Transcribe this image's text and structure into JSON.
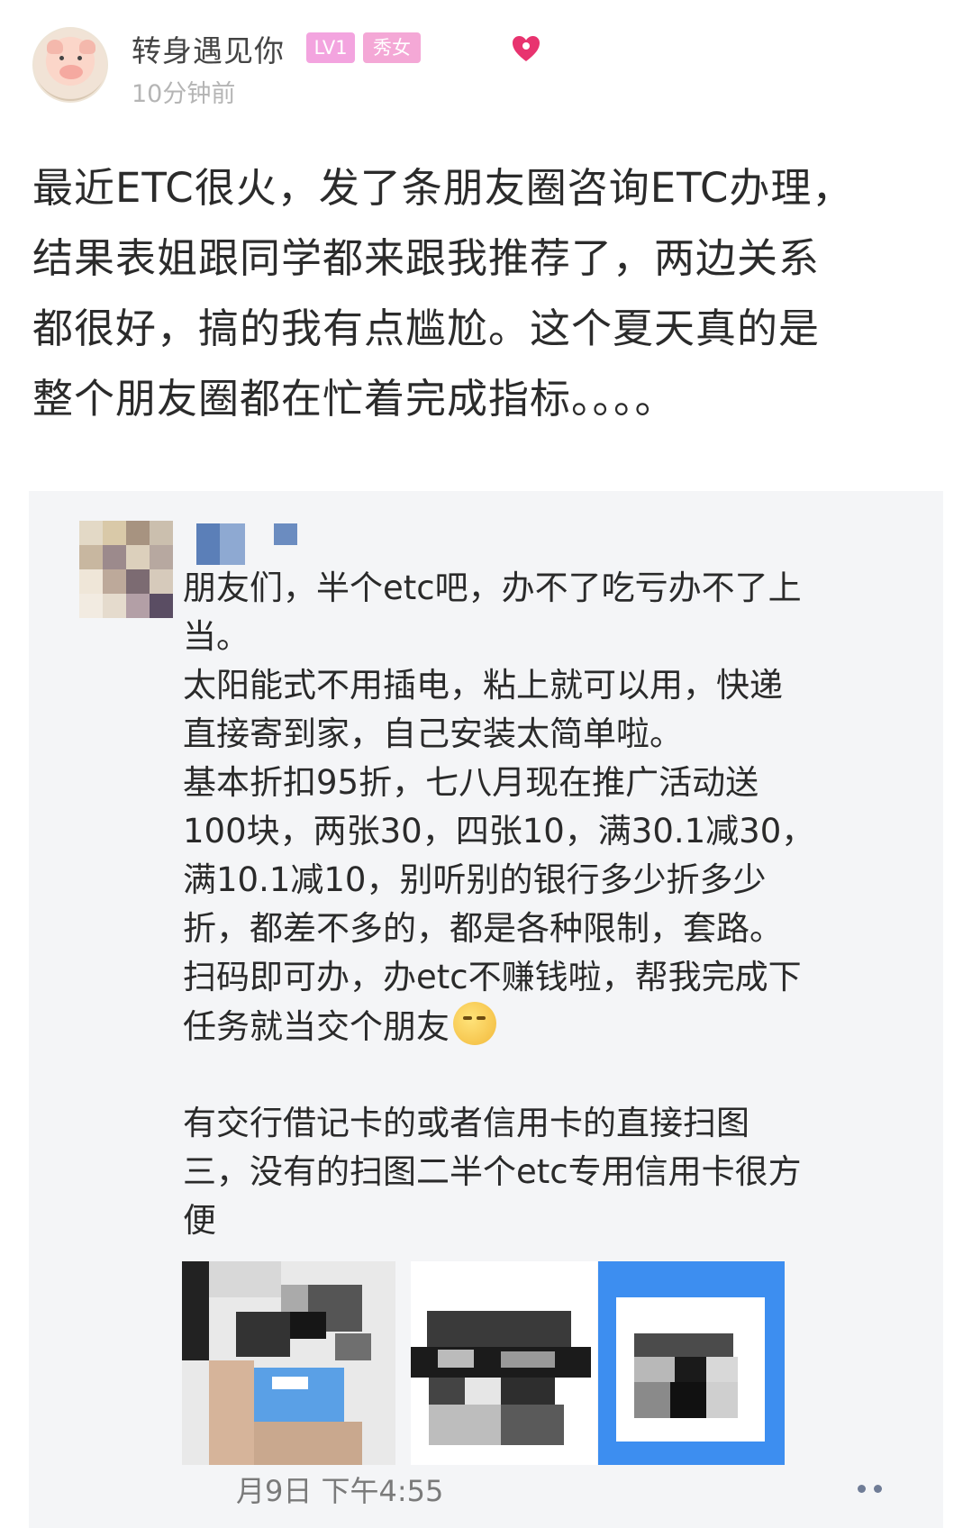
{
  "post": {
    "username": "转身遇见你",
    "level_badge": "LV1",
    "gender_badge": "秀女",
    "time": "10分钟前",
    "body_lines": [
      "最近ETC很火，发了条朋友圈咨询ETC办理，",
      "结果表姐跟同学都来跟我推荐了，两边关系",
      "都很好，搞的我有点尴尬。这个夏天真的是",
      "整个朋友圈都在忙着完成指标。。。。"
    ],
    "badge_color": "#f3a4df",
    "heart_color": "#e8336f"
  },
  "moment": {
    "text_lines": [
      "朋友们，半个etc吧，办不了吃亏办不了上",
      "当。",
      "太阳能式不用插电，粘上就可以用，快递",
      "直接寄到家，自己安装太简单啦。",
      "基本折扣95折，七八月现在推广活动送",
      "100块，两张30，四张10，满30.1减30，",
      "满10.1减10，别听别的银行多少折多少",
      "折，都差不多的，都是各种限制，套路。",
      "扫码即可办，办etc不赚钱啦，帮我完成下",
      "任务就当交个朋友"
    ],
    "text_lines_2": [
      "有交行借记卡的或者信用卡的直接扫图",
      "三，没有的扫图二半个etc专用信用卡很方",
      "便"
    ],
    "time": "月9日 下午4:55",
    "image_names": [
      "card-photo",
      "qr-code-1",
      "qr-code-2"
    ]
  }
}
